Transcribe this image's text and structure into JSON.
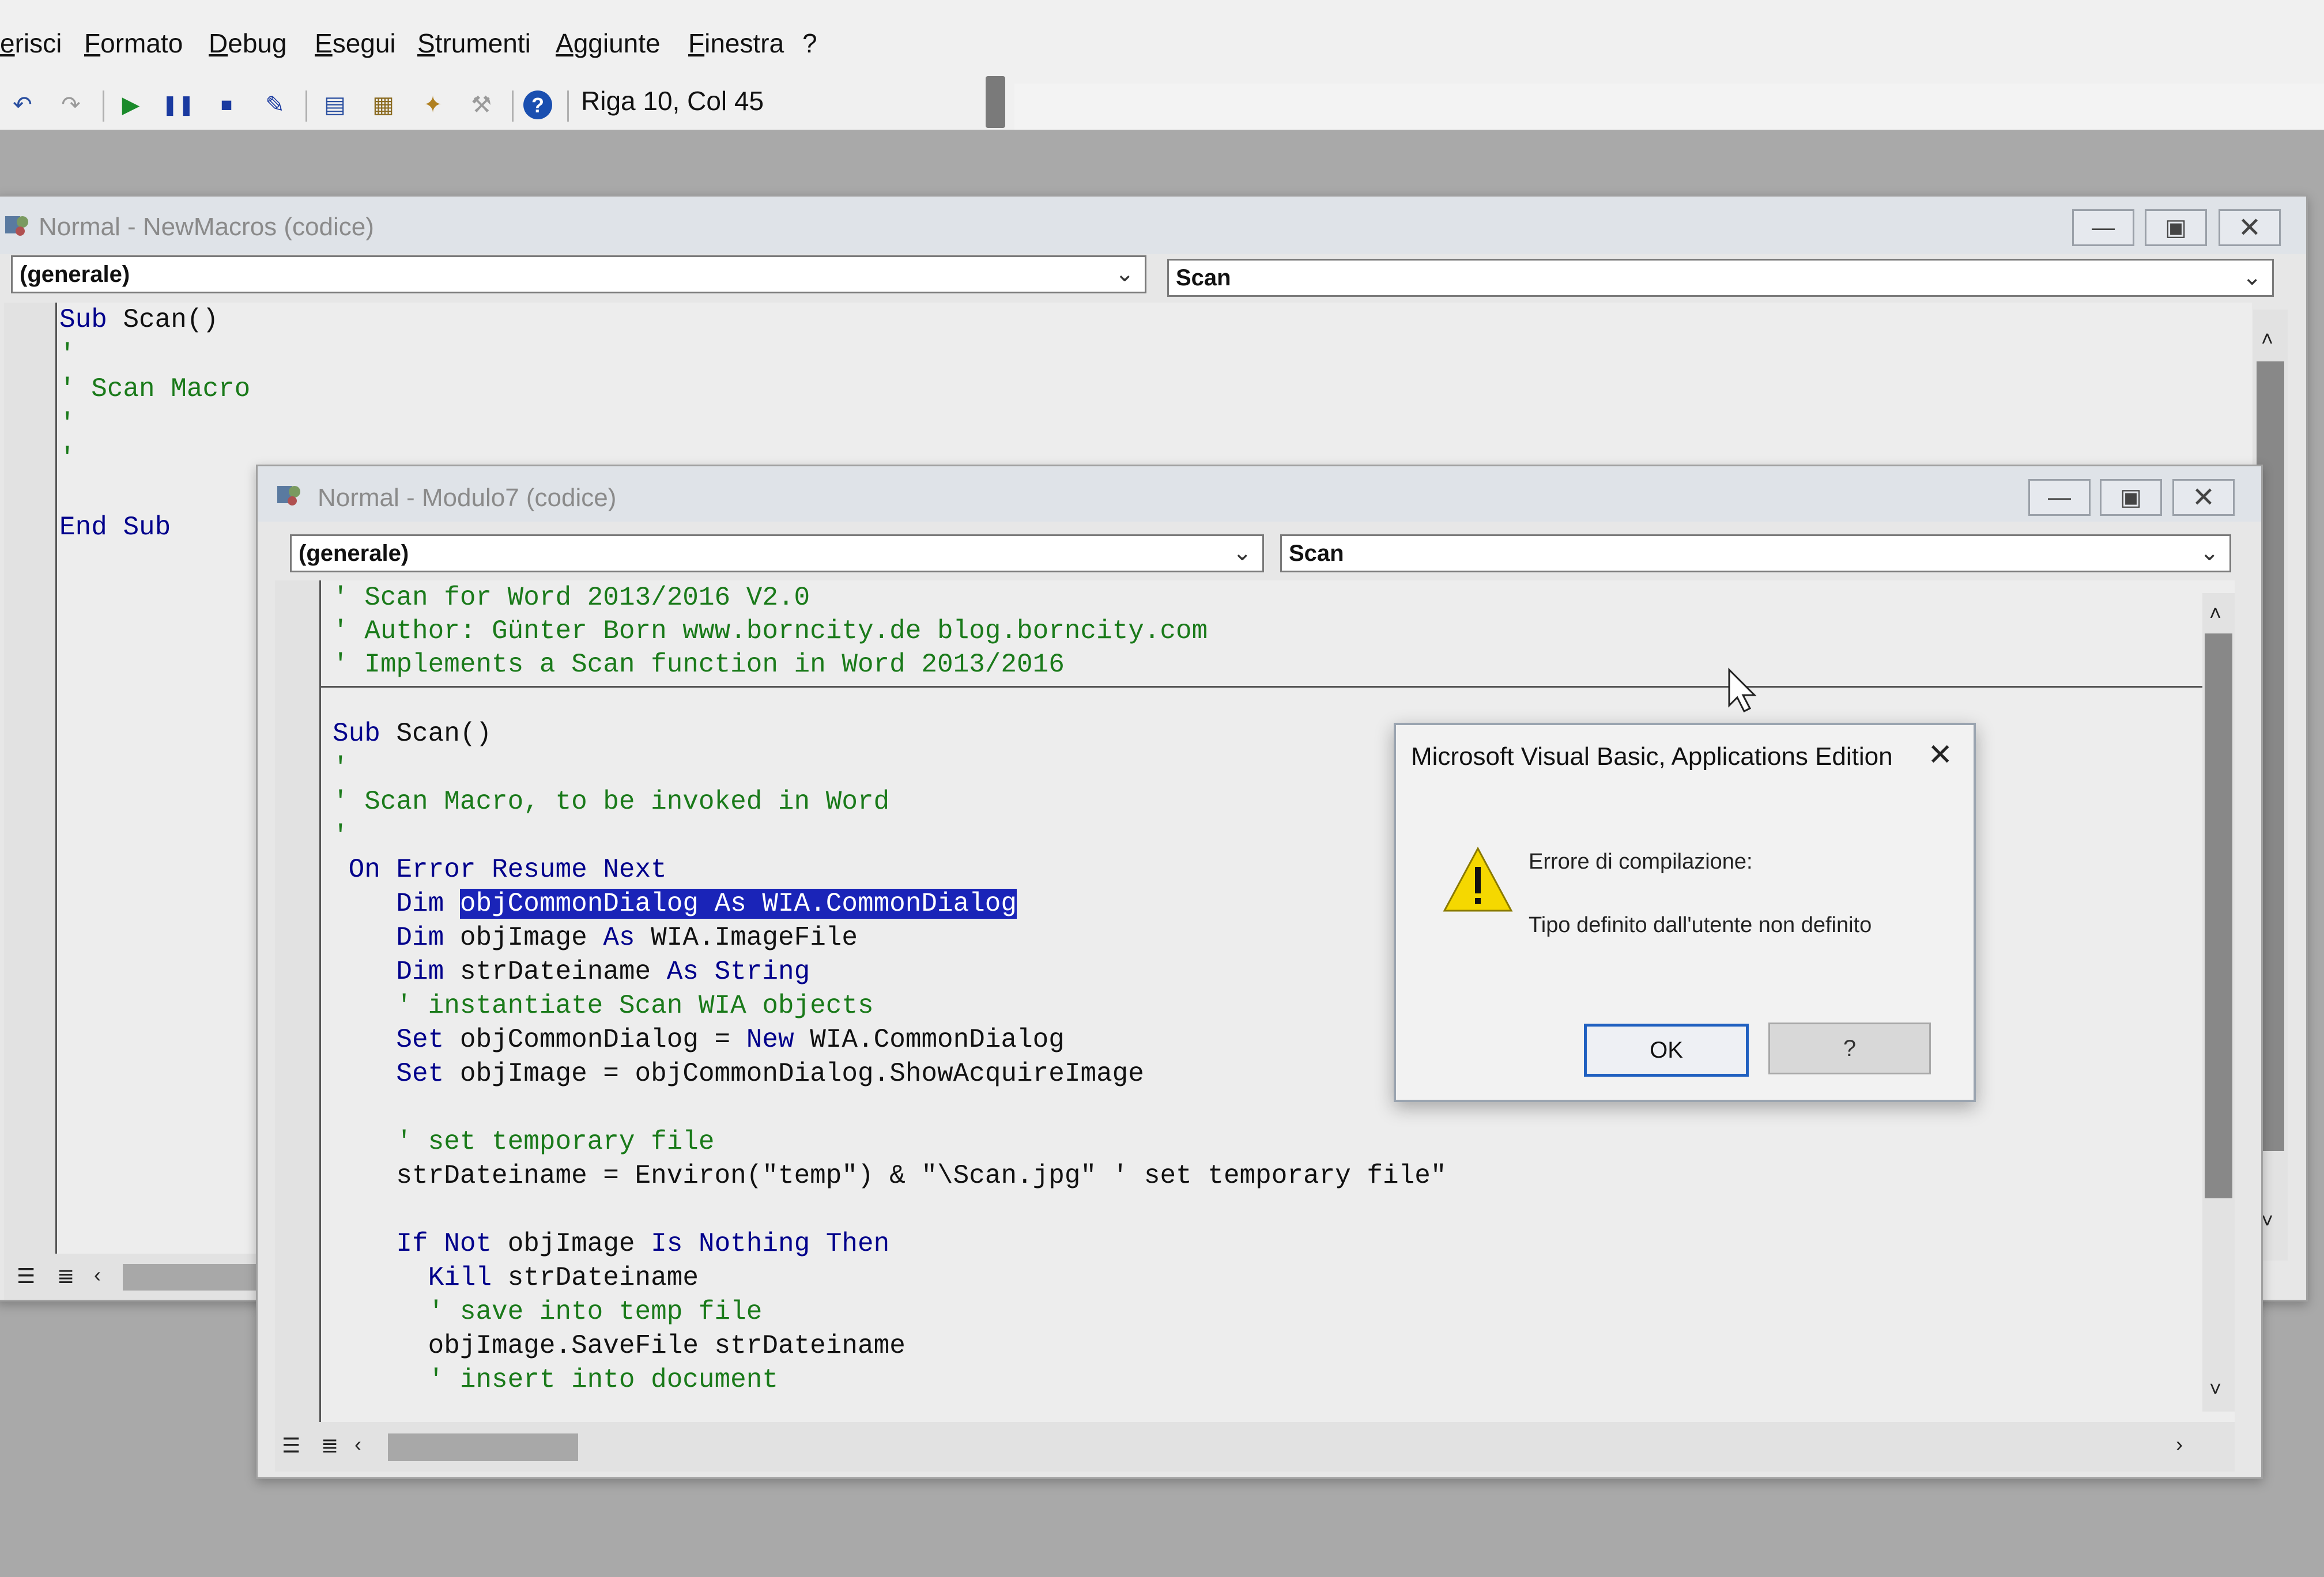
{
  "menu": {
    "items": [
      "erisci",
      "Formato",
      "Debug",
      "Esegui",
      "Strumenti",
      "Aggiunte",
      "Finestra",
      "?"
    ]
  },
  "toolbar": {
    "position_readout": "Riga 10, Col 45",
    "icons": [
      "undo-icon",
      "redo-icon",
      "run-icon",
      "pause-icon",
      "stop-icon",
      "design-mode-icon",
      "project-explorer-icon",
      "properties-icon",
      "object-browser-icon",
      "toolbox-icon",
      "help-icon"
    ]
  },
  "window_back": {
    "title": "Normal - NewMacros (codice)",
    "object_combo": "(generale)",
    "procedure_combo": "Scan",
    "code": [
      [
        {
          "t": "Sub Scan()",
          "c": ""
        }
      ],
      [
        {
          "t": "'",
          "c": "cm"
        }
      ],
      [
        {
          "t": "' Scan Macro",
          "c": "cm"
        }
      ],
      [
        {
          "t": "'",
          "c": "cm"
        }
      ],
      [
        {
          "t": "'",
          "c": "cm"
        }
      ],
      [
        {
          "t": "",
          "c": ""
        }
      ],
      [
        {
          "t": "End Sub",
          "c": ""
        }
      ]
    ]
  },
  "window_front": {
    "title": "Normal - Modulo7 (codice)",
    "object_combo": "(generale)",
    "procedure_combo": "Scan",
    "header_code": [
      [
        {
          "t": "' Scan for Word 2013/2016 V2.0",
          "c": "cm"
        }
      ],
      [
        {
          "t": "' Author: Günter Born www.borncity.de blog.borncity.com",
          "c": "cm"
        }
      ],
      [
        {
          "t": "' Implements a Scan function in Word 2013/2016",
          "c": "cm"
        }
      ]
    ],
    "code": [
      [
        {
          "t": "Sub Scan()",
          "c": ""
        }
      ],
      [
        {
          "t": "'",
          "c": "cm"
        }
      ],
      [
        {
          "t": "' Scan Macro, to be invoked in Word",
          "c": "cm"
        }
      ],
      [
        {
          "t": "'",
          "c": "cm"
        }
      ],
      [
        {
          "t": " On Error Resume Next",
          "c": ""
        }
      ],
      [
        {
          "t": "    Dim ",
          "c": ""
        },
        {
          "t": "objCommonDialog As WIA.CommonDialog",
          "c": "sel"
        }
      ],
      [
        {
          "t": "    Dim objImage As WIA.ImageFile",
          "c": ""
        }
      ],
      [
        {
          "t": "    Dim strDateiname As String",
          "c": ""
        }
      ],
      [
        {
          "t": "    ' instantiate Scan WIA objects",
          "c": "cm"
        }
      ],
      [
        {
          "t": "    Set objCommonDialog = New WIA.CommonDialog",
          "c": ""
        }
      ],
      [
        {
          "t": "    Set objImage = objCommonDialog.ShowAcquireImage",
          "c": ""
        }
      ],
      [
        {
          "t": "",
          "c": ""
        }
      ],
      [
        {
          "t": "    ' set temporary file",
          "c": "cm"
        }
      ],
      [
        {
          "t": "    strDateiname = Environ(\"temp\") & \"\\Scan.jpg\" ' set temporary file\"",
          "c": ""
        }
      ],
      [
        {
          "t": "",
          "c": ""
        }
      ],
      [
        {
          "t": "    If Not objImage Is Nothing Then",
          "c": ""
        }
      ],
      [
        {
          "t": "      Kill strDateiname",
          "c": ""
        }
      ],
      [
        {
          "t": "      ' save into temp file",
          "c": "cm"
        }
      ],
      [
        {
          "t": "      objImage.SaveFile strDateiname",
          "c": ""
        }
      ],
      [
        {
          "t": "      ' insert into document",
          "c": "cm"
        }
      ]
    ]
  },
  "dialog": {
    "title": "Microsoft Visual Basic, Applications Edition",
    "heading": "Errore di compilazione:",
    "message": "Tipo definito dall'utente non definito",
    "ok_label": "OK",
    "help_label": "?"
  },
  "colors": {
    "keyword": "#00008b",
    "comment": "#1a7a1a",
    "selection": "#1a24b8",
    "warning": "#f5d800"
  }
}
